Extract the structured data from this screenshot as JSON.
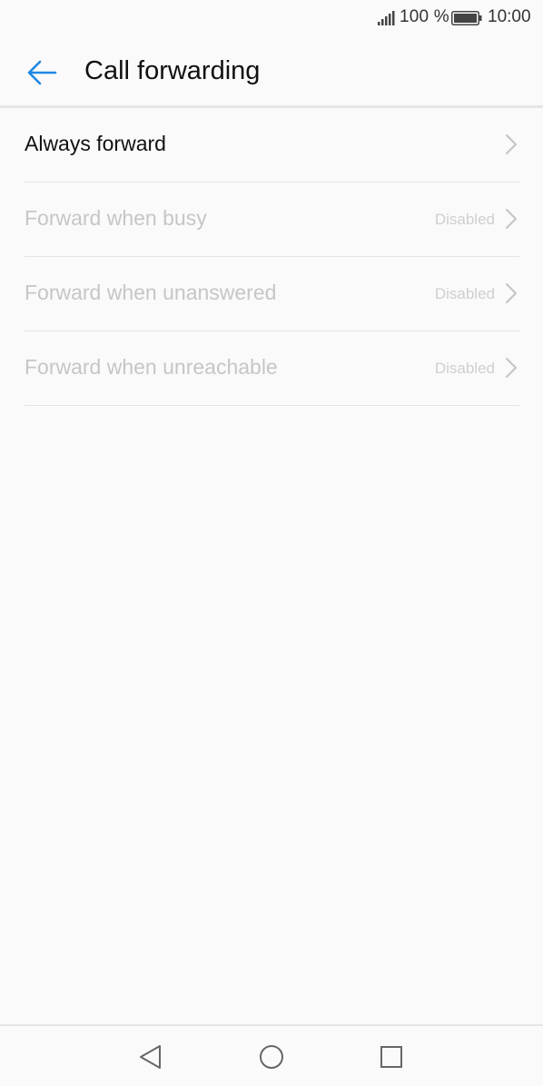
{
  "status_bar": {
    "battery_percent": "100 %",
    "time": "10:00",
    "icons": [
      "signal-icon",
      "battery-icon"
    ]
  },
  "app_bar": {
    "title": "Call forwarding",
    "back_icon": "arrow-left-icon",
    "accent_color": "#1e88e5"
  },
  "settings": {
    "items": [
      {
        "label": "Always forward",
        "status": "",
        "enabled": true
      },
      {
        "label": "Forward when busy",
        "status": "Disabled",
        "enabled": false
      },
      {
        "label": "Forward when unanswered",
        "status": "Disabled",
        "enabled": false
      },
      {
        "label": "Forward when unreachable",
        "status": "Disabled",
        "enabled": false
      }
    ]
  },
  "nav_bar": {
    "icons": [
      "back-triangle-icon",
      "home-circle-icon",
      "recents-square-icon"
    ]
  }
}
